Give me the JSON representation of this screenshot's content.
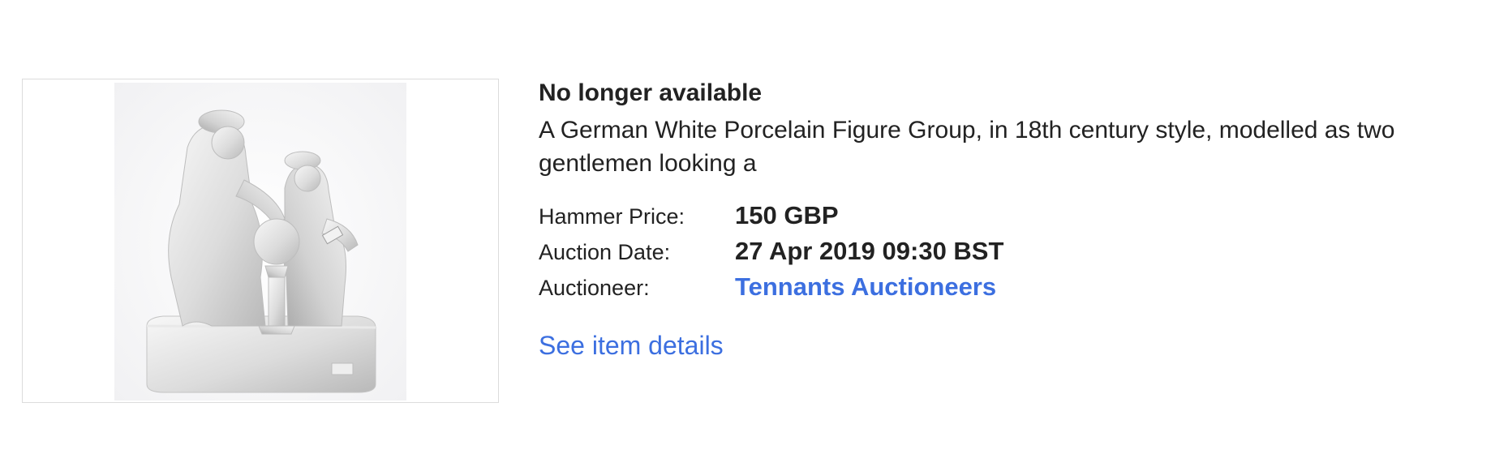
{
  "listing": {
    "image_alt": "White porcelain figure group",
    "status": "No longer available",
    "title": "A German White Porcelain Figure Group, in 18th century style, modelled as two gentlemen looking a",
    "facts": [
      {
        "label": "Hammer Price:",
        "value": "150 GBP",
        "is_link": false
      },
      {
        "label": "Auction Date:",
        "value": "27 Apr 2019 09:30 BST",
        "is_link": false
      },
      {
        "label": "Auctioneer:",
        "value": "Tennants Auctioneers",
        "is_link": true
      }
    ],
    "details_link": "See item details"
  },
  "colors": {
    "link": "#3c6fe0",
    "text": "#222222",
    "border": "#dcdcdc"
  }
}
